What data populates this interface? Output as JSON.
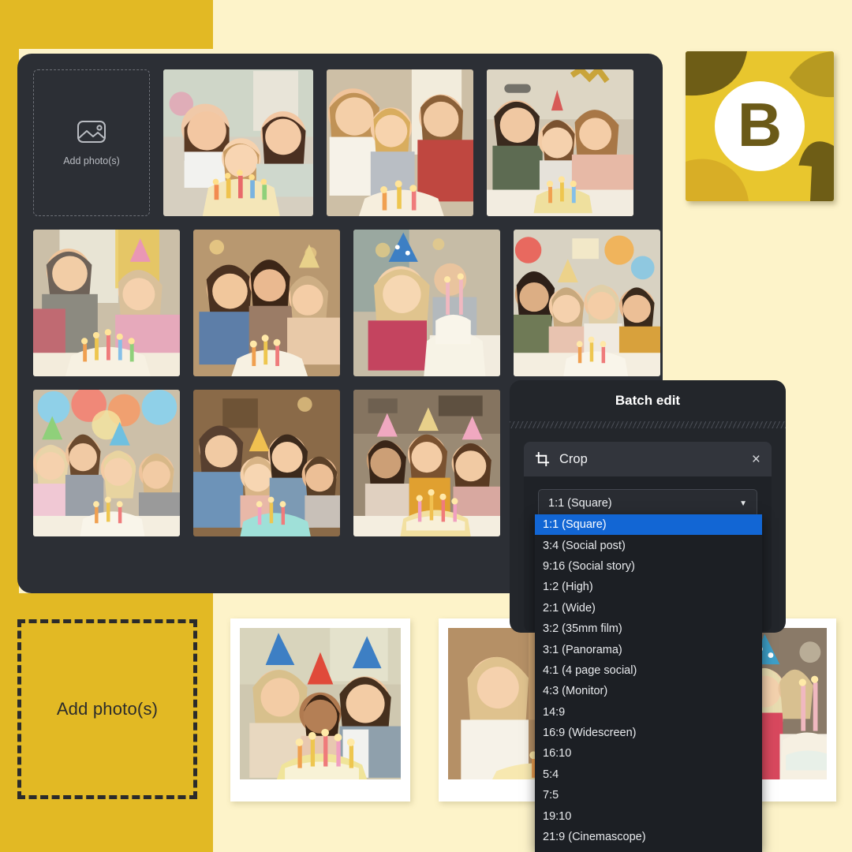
{
  "theme": {
    "background": "#fdf3c9",
    "accent_gold": "#e2b924",
    "panel_dark": "#2c2f35",
    "panel_darker": "#23262b",
    "highlight_blue": "#1266d4",
    "logo_letter_color": "#6b5a18"
  },
  "logo": {
    "letter": "B",
    "name": "brand-logo-b"
  },
  "library_panel": {
    "add_tile": {
      "label": "Add photo(s)",
      "icon": "image-add-icon"
    },
    "rows": [
      {
        "photos": [
          {
            "alt": "Family of three with birthday cake and candles"
          },
          {
            "alt": "Parents and two children celebrating around cake"
          },
          {
            "alt": "Family with party hats and balloons behind cake"
          }
        ]
      },
      {
        "photos": [
          {
            "alt": "Father and daughter with candle-lit cake by window"
          },
          {
            "alt": "Parents hugging daughter behind birthday cake"
          },
          {
            "alt": "Toddler in blue party hat reaching for cake"
          },
          {
            "alt": "Group of children in party hats around white cake"
          }
        ]
      },
      {
        "photos": [
          {
            "alt": "Family with balloons blowing out candles"
          },
          {
            "alt": "Father, mother and two girls behind cake"
          },
          {
            "alt": "Three children in party hats smiling at cake"
          }
        ]
      }
    ]
  },
  "dropzone": {
    "label": "Add photo(s)"
  },
  "polaroids": [
    {
      "alt": "Two adults and child in party hats behind yellow cake"
    },
    {
      "alt": "Mother and laughing girl in front of cake"
    },
    {
      "alt": "Girl in blue polka-dot party hat beside tall candles"
    }
  ],
  "batch_edit": {
    "title": "Batch edit",
    "crop_tool": {
      "label": "Crop",
      "icon": "crop-icon",
      "close_icon": "close-icon",
      "close_label": "×"
    },
    "aspect_select": {
      "value": "1:1 (Square)",
      "caret": "▼",
      "options": [
        "1:1 (Square)",
        "3:4 (Social post)",
        "9:16 (Social story)",
        "1:2 (High)",
        "2:1 (Wide)",
        "3:2 (35mm film)",
        "3:1 (Panorama)",
        "4:1 (4 page social)",
        "4:3 (Monitor)",
        "14:9",
        "16:9 (Widescreen)",
        "16:10",
        "5:4",
        "7:5",
        "19:10",
        "21:9 (Cinemascope)"
      ],
      "selected_index": 0
    }
  }
}
